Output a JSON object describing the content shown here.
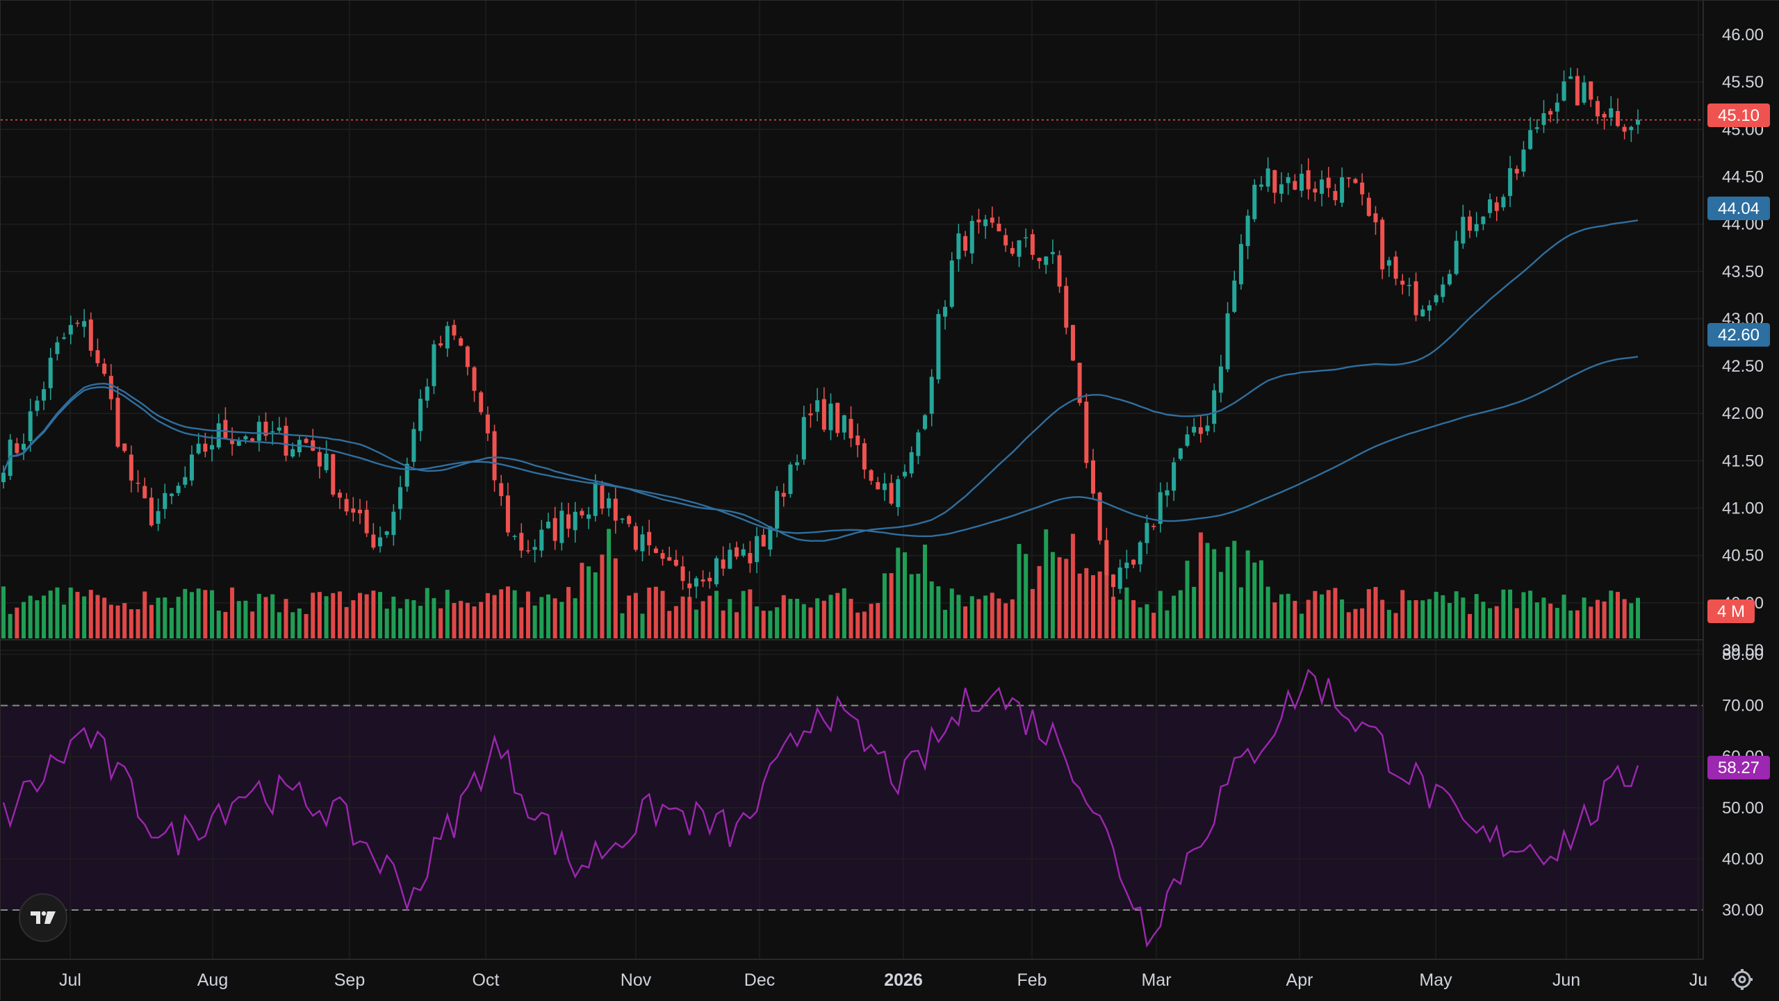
{
  "colors": {
    "background": "#0f0f0f",
    "grid": "#1f1f1f",
    "up": "#26a69a",
    "down": "#ef5350",
    "volume_up": "#1f9e55",
    "volume_down": "#e04848",
    "ma_line": "#2f6f9f",
    "rsi_line": "#9c27b0",
    "rsi_band": "#1c1024",
    "text": "#d1d4dc"
  },
  "logo": {
    "icon": "tradingview-logo-icon",
    "text": "TV"
  },
  "settings": {
    "icon": "gear-icon"
  },
  "badges": {
    "last_price": "45.10",
    "ma_fast": "44.04",
    "ma_slow": "42.60",
    "volume": "4 M",
    "rsi": "58.27"
  },
  "chart_data": {
    "type": "candlestick",
    "time_axis": {
      "labels": [
        "Jul",
        "Aug",
        "Sep",
        "Oct",
        "Nov",
        "Dec",
        "2026",
        "Feb",
        "Mar",
        "Apr",
        "May",
        "Jun",
        "Ju"
      ],
      "bold_label": "2026"
    },
    "price_panel": {
      "ylim": [
        39.0,
        46.2
      ],
      "ticks": [
        "46.00",
        "45.50",
        "45.00",
        "44.50",
        "44.00",
        "43.50",
        "43.00",
        "42.50",
        "42.00",
        "41.50",
        "41.00",
        "40.50",
        "40.00",
        "39.50"
      ],
      "last_price": 45.1,
      "key_closes": [
        {
          "label": "Jul",
          "close": 41.55
        },
        {
          "label": "late Jul high",
          "close": 42.9
        },
        {
          "label": "Aug low",
          "close": 40.95
        },
        {
          "label": "Sep",
          "close": 41.8
        },
        {
          "label": "Oct",
          "close": 41.7
        },
        {
          "label": "Oct low",
          "close": 40.7
        },
        {
          "label": "late Oct high",
          "close": 42.8
        },
        {
          "label": "Nov",
          "close": 40.6
        },
        {
          "label": "Dec",
          "close": 41.1
        },
        {
          "label": "Dec low",
          "close": 40.3
        },
        {
          "label": "2026",
          "close": 40.5
        },
        {
          "label": "mid Jan",
          "close": 42.0
        },
        {
          "label": "Feb",
          "close": 41.2
        },
        {
          "label": "late Feb high",
          "close": 43.9
        },
        {
          "label": "Mar",
          "close": 43.7
        },
        {
          "label": "late Mar low",
          "close": 40.2
        },
        {
          "label": "Apr",
          "close": 41.7
        },
        {
          "label": "mid Apr",
          "close": 44.5
        },
        {
          "label": "May",
          "close": 44.4
        },
        {
          "label": "late May low",
          "close": 43.2
        },
        {
          "label": "Jun",
          "close": 44.2
        },
        {
          "label": "mid Jun",
          "close": 45.4
        },
        {
          "label": "last",
          "close": 45.1
        }
      ]
    },
    "moving_averages": [
      {
        "name": "",
        "last": 44.04
      },
      {
        "name": "",
        "last": 42.6
      }
    ],
    "volume": {
      "last": "4 M"
    },
    "rsi_panel": {
      "ylim": [
        20,
        82
      ],
      "ticks": [
        "80.00",
        "70.00",
        "60.00",
        "50.00",
        "40.00",
        "30.00"
      ],
      "overbought": 70,
      "oversold": 30,
      "last": 58.27,
      "key_values": [
        {
          "label": "Jul",
          "value": 48
        },
        {
          "label": "late Jul",
          "value": 65
        },
        {
          "label": "Aug",
          "value": 43
        },
        {
          "label": "Sep",
          "value": 54
        },
        {
          "label": "Oct",
          "value": 50
        },
        {
          "label": "Oct low",
          "value": 33
        },
        {
          "label": "late Oct",
          "value": 62
        },
        {
          "label": "Nov",
          "value": 38
        },
        {
          "label": "Dec",
          "value": 50
        },
        {
          "label": "2026",
          "value": 45
        },
        {
          "label": "mid Jan",
          "value": 71
        },
        {
          "label": "Feb",
          "value": 55
        },
        {
          "label": "late Feb",
          "value": 74
        },
        {
          "label": "Mar",
          "value": 62
        },
        {
          "label": "late Mar",
          "value": 26
        },
        {
          "label": "Apr",
          "value": 55
        },
        {
          "label": "mid Apr",
          "value": 76
        },
        {
          "label": "May",
          "value": 60
        },
        {
          "label": "late May",
          "value": 44
        },
        {
          "label": "Jun",
          "value": 42
        },
        {
          "label": "last",
          "value": 58.27
        }
      ]
    }
  }
}
